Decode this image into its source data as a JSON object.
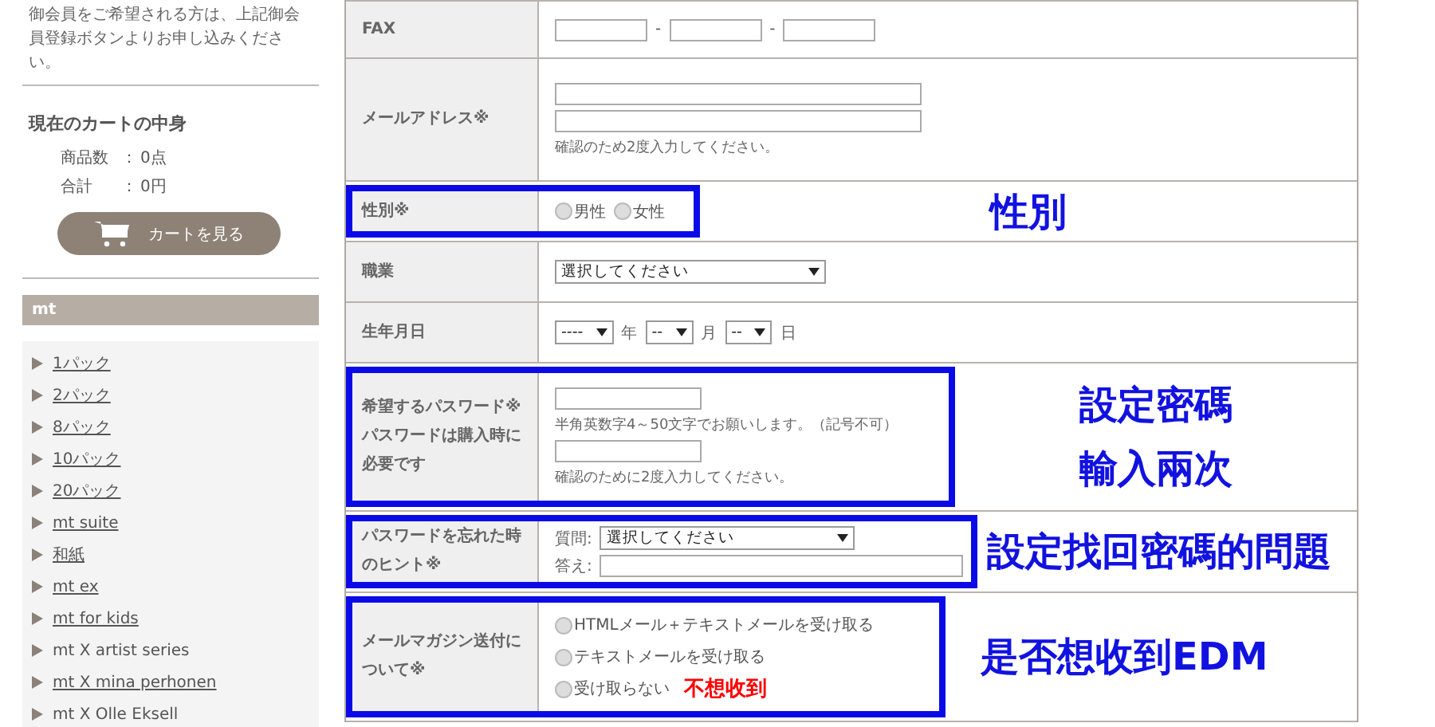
{
  "sidebar": {
    "notice": "御会員をご希望される方は、上記御会員登録ボタンよりお申し込みください。",
    "cart": {
      "title": "現在のカートの中身",
      "rows": [
        {
          "label": "商品数",
          "sep": "：",
          "value": "0点"
        },
        {
          "label": "合計",
          "sep": "：",
          "value": "0円"
        }
      ],
      "button": "カートを見る"
    },
    "category": {
      "title": "mt",
      "items": [
        {
          "label": "1パック",
          "linked": true
        },
        {
          "label": "2パック",
          "linked": true
        },
        {
          "label": "8パック",
          "linked": true
        },
        {
          "label": "10パック",
          "linked": true
        },
        {
          "label": "20パック",
          "linked": true
        },
        {
          "label": "mt suite",
          "linked": true
        },
        {
          "label": "和紙",
          "linked": true
        },
        {
          "label": "mt ex",
          "linked": true
        },
        {
          "label": "mt for kids",
          "linked": true
        },
        {
          "label": "mt X artist series",
          "linked": false
        },
        {
          "label": "mt X mina perhonen",
          "linked": true
        },
        {
          "label": "mt X Olle Eksell",
          "linked": false
        }
      ]
    }
  },
  "form": {
    "rows": [
      {
        "kind": "fax",
        "label": "FAX",
        "highlighted": false,
        "separators": [
          "-",
          "-"
        ]
      },
      {
        "kind": "email",
        "label": "メールアドレス※",
        "highlighted": false,
        "note": "確認のため2度入力してください。"
      },
      {
        "kind": "radio-inline",
        "label": "性別※",
        "highlighted": true,
        "options": [
          {
            "label": "男性",
            "selected": false
          },
          {
            "label": "女性",
            "selected": false
          }
        ],
        "annotation": [
          "性別"
        ]
      },
      {
        "kind": "select",
        "label": "職業",
        "highlighted": false,
        "value": "選択してください"
      },
      {
        "kind": "date",
        "label": "生年月日",
        "highlighted": false,
        "parts": [
          {
            "value": "----",
            "unit": "年"
          },
          {
            "value": "--",
            "unit": "月"
          },
          {
            "value": "--",
            "unit": "日"
          }
        ]
      },
      {
        "kind": "password",
        "label": "希望するパスワード※",
        "sublabel": "パスワードは購入時に必要です",
        "highlighted": true,
        "notes": [
          "半角英数字4～50文字でお願いします。（記号不可）",
          "確認のために2度入力してください。"
        ],
        "annotation": [
          "設定密碼",
          "輸入兩次"
        ]
      },
      {
        "kind": "hint",
        "label": "パスワードを忘れた時のヒント※",
        "highlighted": true,
        "question_label": "質問:",
        "question_value": "選択してください",
        "answer_label": "答え:",
        "annotation": [
          "設定找回密碼的問題"
        ]
      },
      {
        "kind": "radio-stack",
        "label": "メールマガジン送付について※",
        "highlighted": true,
        "options": [
          {
            "label": "HTMLメール＋テキストメールを受け取る",
            "selected": false
          },
          {
            "label": "テキストメールを受け取る",
            "selected": false
          },
          {
            "label": "受け取らない",
            "selected": false,
            "note": "不想收到"
          }
        ],
        "annotation": [
          "是否想收到EDM"
        ]
      }
    ]
  }
}
